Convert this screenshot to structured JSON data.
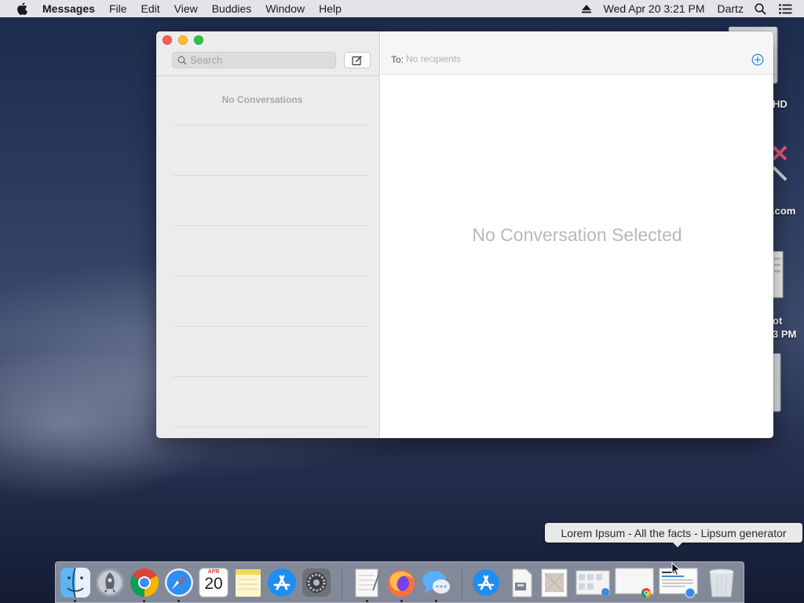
{
  "menubar": {
    "apple_icon": "apple-icon",
    "app_name": "Messages",
    "items": [
      "File",
      "Edit",
      "View",
      "Buddies",
      "Window",
      "Help"
    ],
    "datetime": "Wed Apr 20  3:21 PM",
    "user": "Dartz"
  },
  "desktop": {
    "labels": [
      "HD",
      ".com",
      "ot",
      "3 PM"
    ]
  },
  "window": {
    "search": {
      "placeholder": "Search",
      "value": ""
    },
    "sidebar": {
      "empty_text": "No Conversations"
    },
    "to_bar": {
      "label": "To:",
      "placeholder": "No recipients"
    },
    "main": {
      "empty_text": "No Conversation Selected"
    }
  },
  "tooltip": {
    "text": "Lorem Ipsum - All the facts - Lipsum generator"
  },
  "dock": {
    "calendar": {
      "month": "APR",
      "day": "20"
    },
    "apps": [
      "finder",
      "launchpad",
      "chrome",
      "safari",
      "calendar",
      "notes",
      "app-store",
      "system-preferences",
      "textedit",
      "firefox",
      "messages",
      "app-store-download",
      "archive",
      "preview-document",
      "screenshot-window",
      "chrome-window",
      "safari-window",
      "trash"
    ]
  },
  "colors": {
    "accent": "#3b88e0",
    "close": "#fc5f57",
    "minimize": "#fdbc2e",
    "maximize": "#28c840"
  }
}
